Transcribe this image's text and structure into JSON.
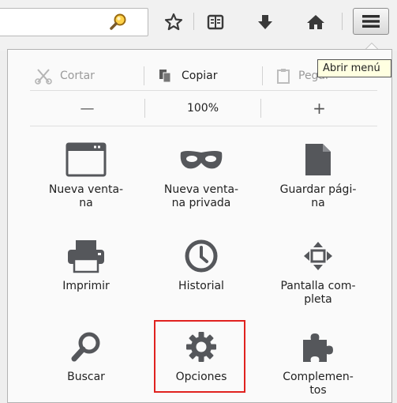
{
  "toolbar": {
    "search_value": "",
    "icons": [
      "search-icon",
      "bookmark-star-icon",
      "reading-list-icon",
      "download-icon",
      "home-icon",
      "hamburger-menu-icon"
    ],
    "tooltip": "Abrir menú"
  },
  "edit": {
    "cut": "Cortar",
    "copy": "Copiar",
    "paste": "Pegar"
  },
  "zoom": {
    "minus": "—",
    "level": "100%",
    "plus": "+"
  },
  "items": {
    "new_window": "Nueva venta-\nna",
    "private_window": "Nueva venta-\nna privada",
    "save_page": "Guardar pági-\nna",
    "print": "Imprimir",
    "history": "Historial",
    "fullscreen": "Pantalla com-\npleta",
    "find": "Buscar",
    "options": "Opciones",
    "addons": "Complemen-\ntos"
  },
  "colors": {
    "highlight": "#e0221f",
    "icon": "#55575b",
    "tooltip_bg": "#ffffe1"
  }
}
